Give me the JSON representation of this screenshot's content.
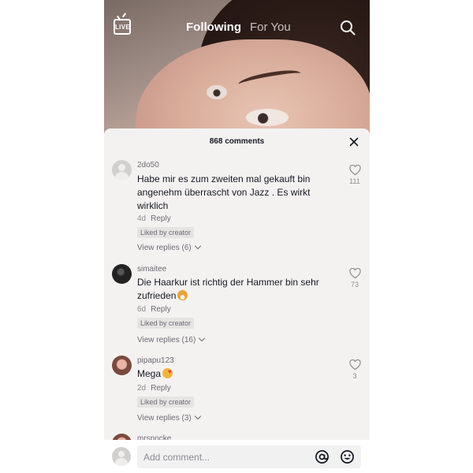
{
  "top_nav": {
    "live_label": "LIVE",
    "tabs": [
      {
        "label": "Following",
        "active": true
      },
      {
        "label": "For You",
        "active": false
      }
    ],
    "icons": [
      "live-icon",
      "search-icon"
    ]
  },
  "comments_sheet": {
    "count_label": "868 comments",
    "close_icon": "close-icon",
    "comments": [
      {
        "username": "2do50",
        "text": "Habe mir es zum zweiten mal gekauft bin angenehm überrascht von Jazz . Es wirkt wirklich",
        "age": "4d",
        "reply_label": "Reply",
        "badge": "Liked by creator",
        "view_replies": "View replies (6)",
        "likes": "111",
        "avatar": "default-avatar"
      },
      {
        "username": "simaitee",
        "text": "Die Haarkur ist richtig der Hammer bin sehr zufrieden",
        "emoji": "grinning-face",
        "age": "6d",
        "reply_label": "Reply",
        "badge": "Liked by creator",
        "view_replies": "View replies (16)",
        "likes": "73",
        "avatar": "dark-avatar"
      },
      {
        "username": "pipapu123",
        "text": "Mega",
        "emoji": "smiling-face-with-hearts",
        "age": "2d",
        "reply_label": "Reply",
        "badge": "Liked by creator",
        "view_replies": "View replies (3)",
        "likes": "3",
        "avatar": "photo-avatar"
      },
      {
        "username": "mrspocke",
        "avatar": "photo-avatar"
      }
    ]
  },
  "comment_input": {
    "placeholder": "Add comment...",
    "icons": [
      "mention-icon",
      "emoji-icon"
    ]
  },
  "colors": {
    "sheet_background": "#f4f2f1",
    "primary_text": "#161823",
    "secondary_text": "#8a8b91"
  }
}
